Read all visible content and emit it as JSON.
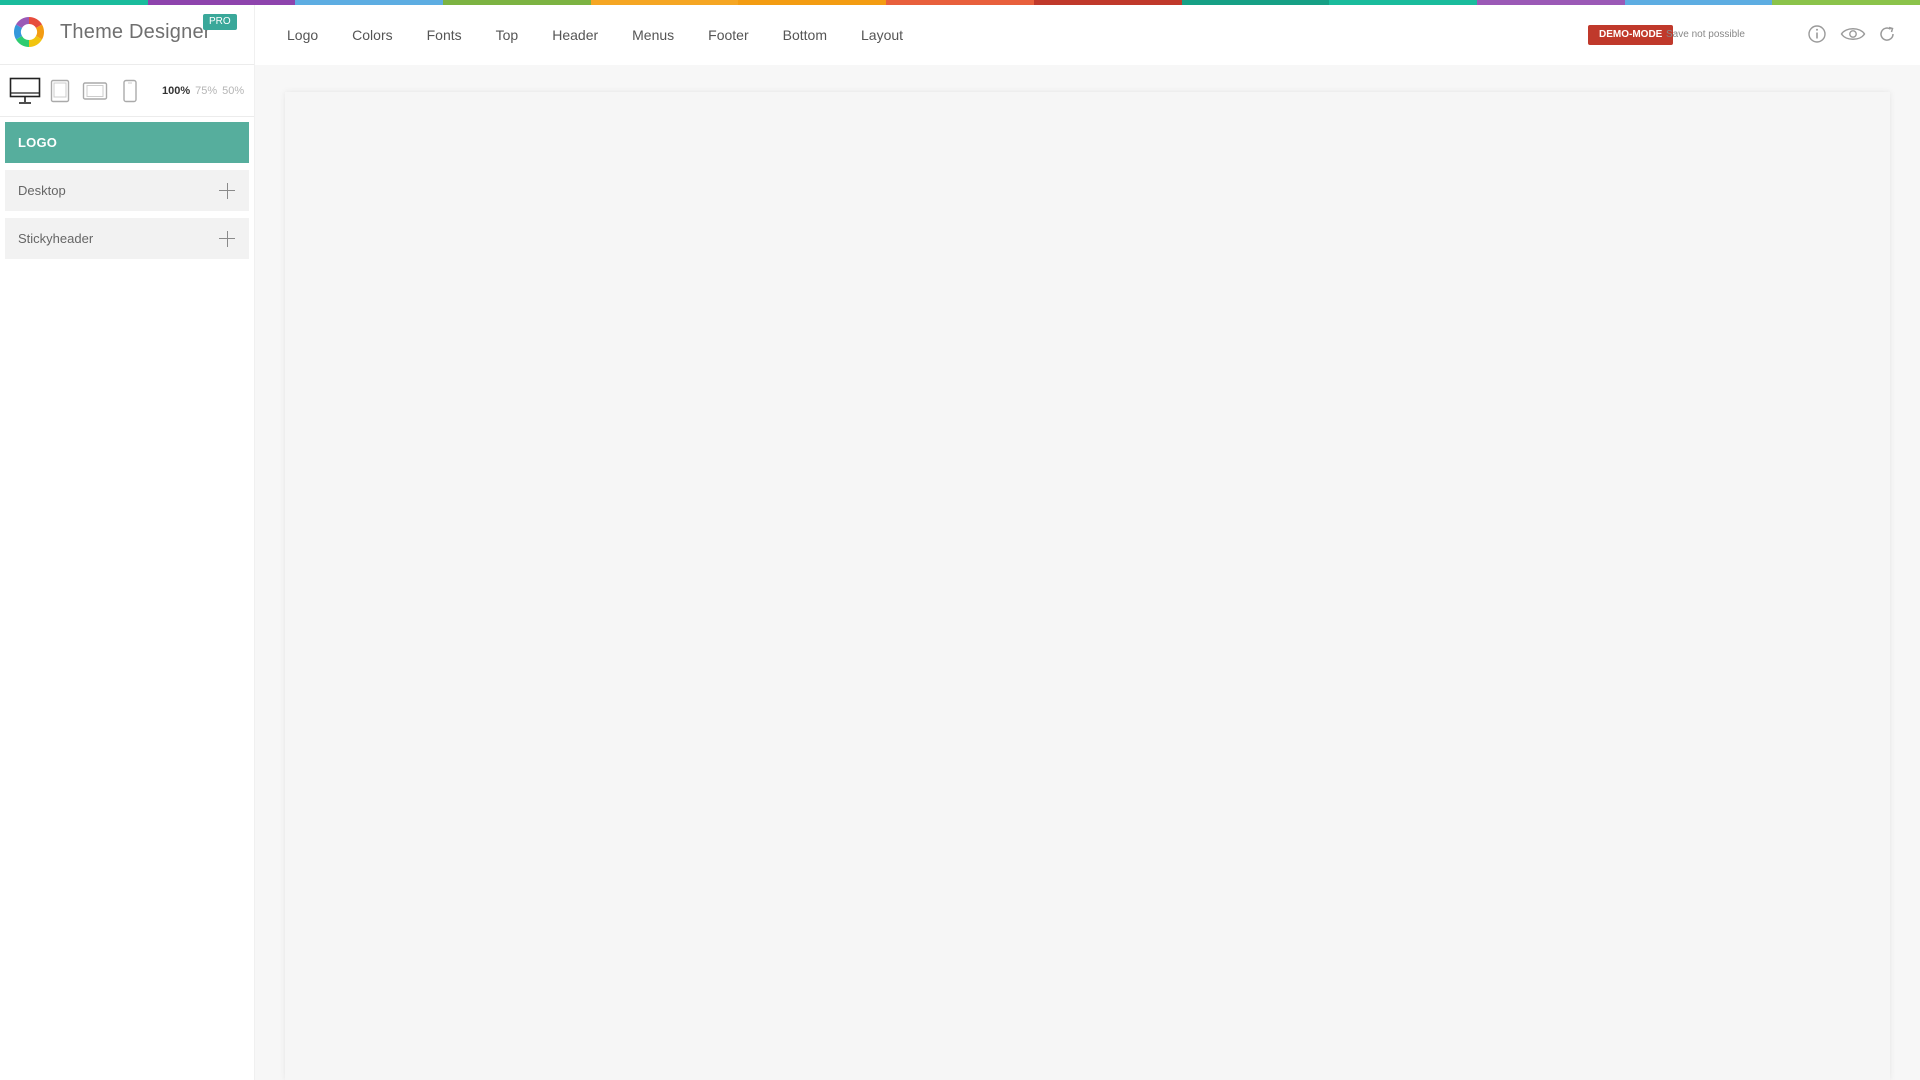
{
  "app": {
    "title": "Theme Designer",
    "badge": "PRO",
    "logo_icon": "color-wheel-icon"
  },
  "stripe_colors": [
    "#1abc9c",
    "#8e44ad",
    "#5dade2",
    "#7cb342",
    "#f5a623",
    "#f39c12",
    "#e8603c",
    "#c0392b",
    "#16a085",
    "#1abc9c",
    "#9b59b6",
    "#5dade2",
    "#8bc34a"
  ],
  "devices": [
    {
      "name": "desktop",
      "icon": "desktop-monitor-icon"
    },
    {
      "name": "tablet-portrait",
      "icon": "tablet-portrait-icon"
    },
    {
      "name": "tablet-landscape",
      "icon": "tablet-landscape-icon"
    },
    {
      "name": "phone",
      "icon": "phone-icon"
    }
  ],
  "zoom": {
    "options": [
      "100%",
      "75%",
      "50%"
    ],
    "selected": "100%"
  },
  "panel": {
    "header": "LOGO",
    "items": [
      "Desktop",
      "Stickyheader"
    ]
  },
  "nav": {
    "items": [
      "Logo",
      "Colors",
      "Fonts",
      "Top",
      "Header",
      "Menus",
      "Footer",
      "Bottom",
      "Layout"
    ]
  },
  "status": {
    "demo_badge": "DEMO-MODE",
    "save_text": "Save not possible",
    "demo_color": "#c0392b"
  },
  "top_actions": [
    {
      "icon": "info-icon"
    },
    {
      "icon": "eye-icon"
    },
    {
      "icon": "refresh-icon"
    }
  ],
  "accent_color": "#56ae9d"
}
